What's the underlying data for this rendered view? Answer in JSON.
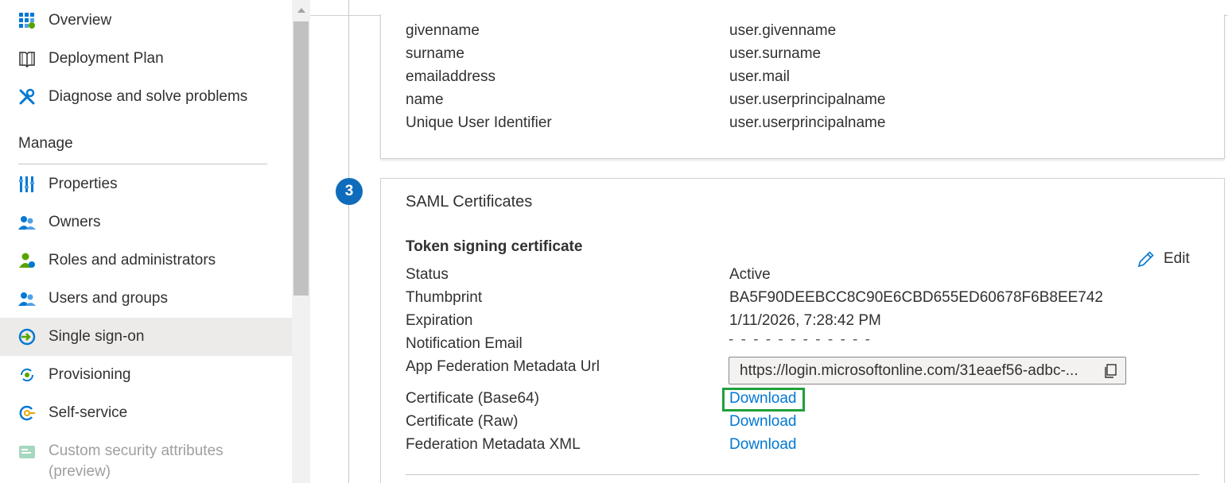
{
  "sidebar": {
    "items": [
      {
        "label": "Overview",
        "icon": "grid-icon"
      },
      {
        "label": "Deployment Plan",
        "icon": "book-icon"
      },
      {
        "label": "Diagnose and solve problems",
        "icon": "wrench-icon"
      }
    ],
    "section_heading": "Manage",
    "manage_items": [
      {
        "label": "Properties",
        "icon": "properties-icon"
      },
      {
        "label": "Owners",
        "icon": "owners-icon"
      },
      {
        "label": "Roles and administrators",
        "icon": "roles-icon"
      },
      {
        "label": "Users and groups",
        "icon": "users-groups-icon"
      },
      {
        "label": "Single sign-on",
        "icon": "sso-icon",
        "selected": true
      },
      {
        "label": "Provisioning",
        "icon": "provisioning-icon"
      },
      {
        "label": "Self-service",
        "icon": "self-service-icon"
      },
      {
        "label": "Custom security attributes\n(preview)",
        "icon": "security-attributes-icon",
        "disabled": true
      }
    ]
  },
  "attributes": {
    "rows": [
      {
        "name": "givenname",
        "value": "user.givenname"
      },
      {
        "name": "surname",
        "value": "user.surname"
      },
      {
        "name": "emailaddress",
        "value": "user.mail"
      },
      {
        "name": "name",
        "value": "user.userprincipalname"
      },
      {
        "name": "Unique User Identifier",
        "value": "user.userprincipalname"
      }
    ]
  },
  "saml": {
    "step_number": "3",
    "title": "SAML Certificates",
    "subtitle": "Token signing certificate",
    "edit_label": "Edit",
    "fields": {
      "status_label": "Status",
      "status_value": "Active",
      "thumbprint_label": "Thumbprint",
      "thumbprint_value": "BA5F90DEEBCC8C90E6CBD655ED60678F6B8EE742",
      "expiration_label": "Expiration",
      "expiration_value": "1/11/2026, 7:28:42 PM",
      "notification_label": "Notification Email",
      "metadata_url_label": "App Federation Metadata Url",
      "metadata_url_value": "https://login.microsoftonline.com/31eaef56-adbc-...",
      "cert_base64_label": "Certificate (Base64)",
      "cert_raw_label": "Certificate (Raw)",
      "fed_xml_label": "Federation Metadata XML",
      "download_label": "Download"
    }
  },
  "colors": {
    "accent": "#0078d4",
    "step_badge": "#0f6cbd",
    "highlight_box": "#1ea03a",
    "selected_bg": "#edebe9"
  }
}
